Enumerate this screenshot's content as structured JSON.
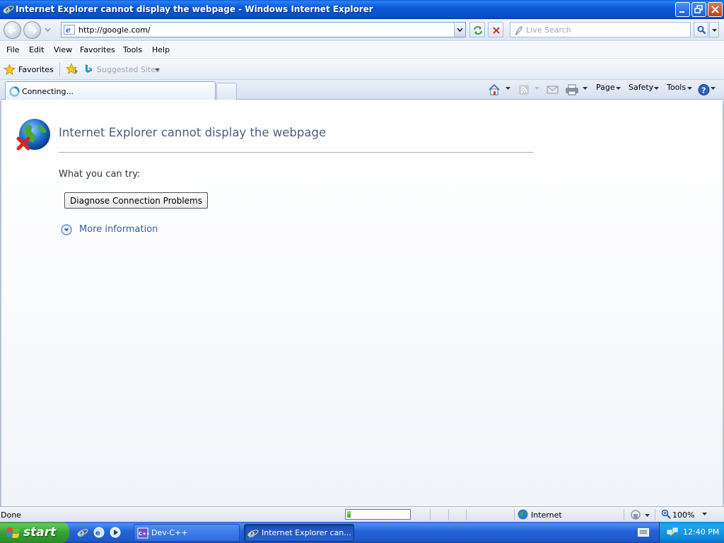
{
  "window": {
    "title": "Internet Explorer cannot display the webpage - Windows Internet Explorer"
  },
  "address_bar": {
    "url": "http://google.com/"
  },
  "search": {
    "placeholder": "Live Search"
  },
  "menu": {
    "items": [
      "File",
      "Edit",
      "View",
      "Favorites",
      "Tools",
      "Help"
    ]
  },
  "favorites_bar": {
    "favorites_label": "Favorites",
    "suggested_sites_label": "Suggested Sites"
  },
  "tabs": {
    "active_label": "Connecting..."
  },
  "command_bar": {
    "page_label": "Page",
    "safety_label": "Safety",
    "tools_label": "Tools"
  },
  "content": {
    "error_title": "Internet Explorer cannot display the webpage",
    "try_label": "What you can try:",
    "diagnose_button": "Diagnose Connection Problems",
    "more_info_link": "More information"
  },
  "status_bar": {
    "status_text": "Done",
    "progress": 0.06,
    "zone_label": "Internet",
    "zoom_label": "100%"
  },
  "taskbar": {
    "start_label": "start",
    "tasks": [
      {
        "label": "Dev-C++"
      },
      {
        "label": "Internet Explorer can..."
      }
    ],
    "clock": "12:40 PM"
  },
  "colors": {
    "title_bar": "#0850c8",
    "error_title": "#4a5e7c",
    "link": "#3a5f8c",
    "taskbar": "#2563d6",
    "start_button": "#37a233"
  }
}
